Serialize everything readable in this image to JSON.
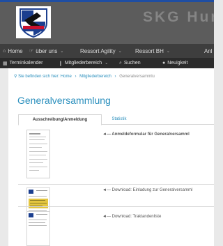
{
  "site": {
    "title": "SKG Hund",
    "logo_icon": "club-crest-logo"
  },
  "nav": {
    "items": [
      {
        "icon": "home-icon",
        "label": "Home",
        "has_menu": false
      },
      {
        "icon": "hand-icon",
        "label": "über uns",
        "has_menu": true
      },
      {
        "icon": "",
        "label": "Ressort Agility",
        "has_menu": true
      },
      {
        "icon": "",
        "label": "Ressort BH",
        "has_menu": true
      },
      {
        "icon": "",
        "label": "Anl",
        "has_menu": false
      }
    ]
  },
  "subnav": {
    "items": [
      {
        "icon": "calendar-icon",
        "label": "Terminkalender",
        "has_menu": false
      },
      {
        "icon": "pin-icon",
        "label": "Mitgliederbereich",
        "has_menu": true
      },
      {
        "icon": "search-icon",
        "label": "Suchen",
        "has_menu": false
      },
      {
        "icon": "chat-icon",
        "label": "Neuigkeit",
        "has_menu": false
      }
    ]
  },
  "breadcrumb": {
    "prefix": "Sie befinden sich hier:",
    "items": [
      "Home",
      "Mitgliederbereich",
      "Generalversammlu"
    ]
  },
  "page": {
    "title": "Generalversammlung"
  },
  "tabs": [
    {
      "label": "Ausschreibung/Anmeldung",
      "active": true
    },
    {
      "label": "Statistik",
      "active": false
    }
  ],
  "rows": [
    {
      "label": "◄— Anmeldeformular für Generalversamml",
      "bold": true
    },
    {
      "label": "◄— Download: Einladung zur Generalversamml",
      "bold": false
    },
    {
      "label": "◄— Download: Traktandenliste",
      "bold": false
    }
  ]
}
